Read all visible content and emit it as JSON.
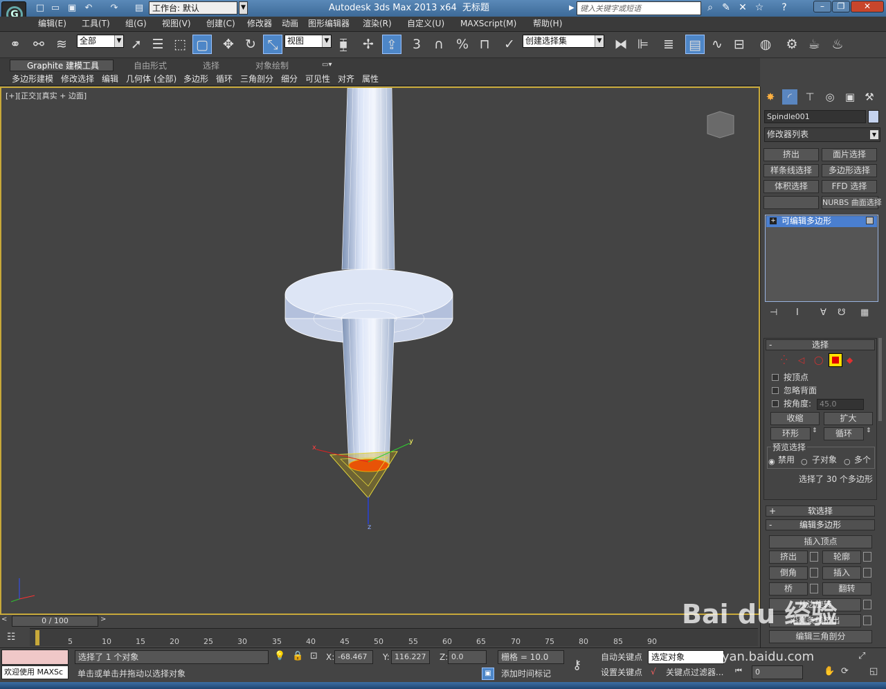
{
  "window": {
    "workspace_label": "工作台: 默认",
    "app_title": "Autodesk 3ds Max  2013 x64",
    "doc_title": "无标题",
    "search_placeholder": "键入关键字或短语"
  },
  "menubar": [
    "编辑(E)",
    "工具(T)",
    "组(G)",
    "视图(V)",
    "创建(C)",
    "修改器",
    "动画",
    "图形编辑器",
    "渲染(R)",
    "自定义(U)",
    "MAXScript(M)",
    "帮助(H)"
  ],
  "toolbar": {
    "selection_filter": "全部",
    "ref_coord": "视图",
    "named_selection": "创建选择集",
    "snap_labels": [
      "3",
      "%"
    ]
  },
  "ribbon": {
    "tabs": [
      "Graphite 建模工具",
      "自由形式",
      "选择",
      "对象绘制"
    ],
    "subtabs": [
      "多边形建模",
      "修改选择",
      "编辑",
      "几何体 (全部)",
      "多边形",
      "循环",
      "三角剖分",
      "细分",
      "可见性",
      "对齐",
      "属性"
    ]
  },
  "viewport": {
    "label": "[+][正交][真实 + 边面]",
    "gizmo_axes": [
      "x",
      "y",
      "z"
    ]
  },
  "command_panel": {
    "object_name": "Spindle001",
    "modifier_list": "修改器列表",
    "modifier_buttons": [
      "挤出",
      "面片选择",
      "样条线选择",
      "多边形选择",
      "体积选择",
      "FFD 选择",
      "",
      "NURBS 曲面选择"
    ],
    "stack_item": "可编辑多边形",
    "selection_rollout": {
      "title": "选择",
      "by_vertex": "按顶点",
      "ignore_backfacing": "忽略背面",
      "by_angle": "按角度:",
      "angle_value": "45.0",
      "shrink": "收缩",
      "grow": "扩大",
      "ring": "环形",
      "loop": "循环",
      "preview_label": "预览选择",
      "preview_options": [
        "禁用",
        "子对象",
        "多个"
      ],
      "status": "选择了 30 个多边形"
    },
    "soft_selection": "软选择",
    "edit_poly": {
      "title": "编辑多边形",
      "insert_vertex": "插入顶点",
      "buttons": [
        "挤出",
        "轮廓",
        "倒角",
        "插入",
        "桥",
        "翻转"
      ],
      "hinge": "从边旋转",
      "extrude_spline": "沿样条线挤出",
      "edit_tri": "编辑三角剖分"
    }
  },
  "timeline": {
    "slider": "0 / 100",
    "ticks": [
      "5",
      "10",
      "15",
      "20",
      "25",
      "30",
      "35",
      "40",
      "45",
      "50",
      "55",
      "60",
      "65",
      "70",
      "75",
      "80",
      "85",
      "90"
    ]
  },
  "statusbar": {
    "welcome": "欢迎使用 MAXSc",
    "selected": "选择了 1 个对象",
    "prompt": "单击或单击并拖动以选择对象",
    "x_label": "X:",
    "x_value": "-68.467",
    "y_label": "Y:",
    "y_value": "116.227",
    "z_label": "Z:",
    "z_value": "0.0",
    "grid": "栅格 = 10.0",
    "add_time_tag": "添加时间标记",
    "auto_key": "自动关键点",
    "set_key": "设置关键点",
    "selected_dropdown": "选定对象",
    "key_filters": "关键点过滤器...",
    "frame_value": "0"
  },
  "watermark": {
    "brand": "Bai du 经验",
    "url": "jingyan.baidu.com"
  },
  "colors": {
    "viewport_border": "#c8a93a",
    "selection_red": "#ff2a00",
    "title_blue": "#4a7aab"
  }
}
